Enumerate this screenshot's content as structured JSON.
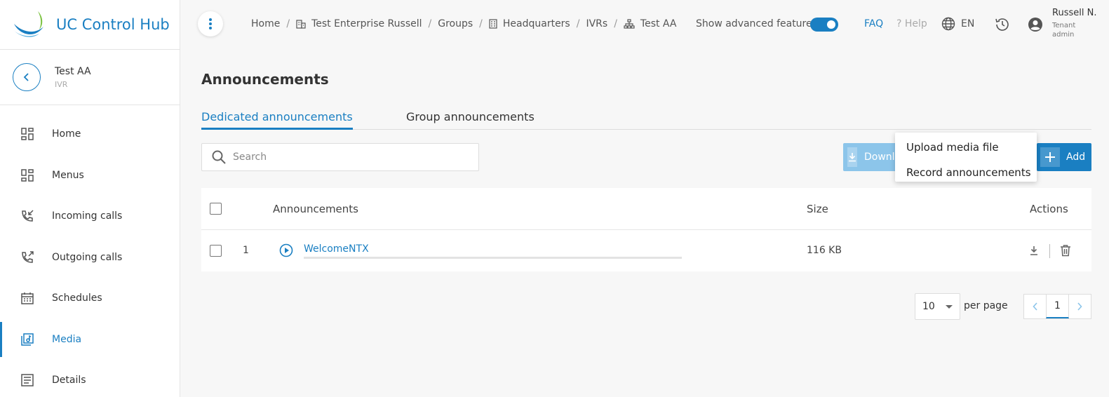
{
  "app": {
    "title": "UC Control Hub"
  },
  "entity": {
    "name": "Test AA",
    "type": "IVR"
  },
  "sidebar": {
    "items": [
      {
        "label": "Home",
        "icon": "dashboard-icon"
      },
      {
        "label": "Menus",
        "icon": "menus-icon"
      },
      {
        "label": "Incoming calls",
        "icon": "incoming-call-icon"
      },
      {
        "label": "Outgoing calls",
        "icon": "outgoing-call-icon"
      },
      {
        "label": "Schedules",
        "icon": "calendar-icon"
      },
      {
        "label": "Media",
        "icon": "media-icon",
        "active": true
      },
      {
        "label": "Details",
        "icon": "details-icon"
      }
    ]
  },
  "breadcrumb": [
    "Home",
    "Test Enterprise Russell",
    "Groups",
    "Headquarters",
    "IVRs",
    "Test AA"
  ],
  "header": {
    "advanced_label": "Show advanced features",
    "advanced_enabled": true,
    "faq": "FAQ",
    "help": "Help",
    "help_prefix": "?",
    "language": "EN",
    "user_name": "Russell N.",
    "user_role": "Tenant admin"
  },
  "page": {
    "title": "Announcements"
  },
  "tabs": [
    {
      "label": "Dedicated announcements",
      "active": true
    },
    {
      "label": "Group announcements",
      "active": false
    }
  ],
  "search": {
    "placeholder": "Search"
  },
  "toolbar": {
    "download_label": "Download",
    "add_label": "Add"
  },
  "add_menu": {
    "items": [
      "Upload media file",
      "Record announcements"
    ]
  },
  "table": {
    "headers": {
      "name": "Announcements",
      "size": "Size",
      "actions": "Actions"
    },
    "rows": [
      {
        "num": "1",
        "name": "WelcomeNTX",
        "size": "116 KB",
        "progress": 0
      }
    ]
  },
  "pagination": {
    "per_page_value": "10",
    "per_page_label": "per page",
    "current_page": "1"
  },
  "colors": {
    "accent": "#1a7fc2",
    "accent_light": "#8cc5ea"
  }
}
